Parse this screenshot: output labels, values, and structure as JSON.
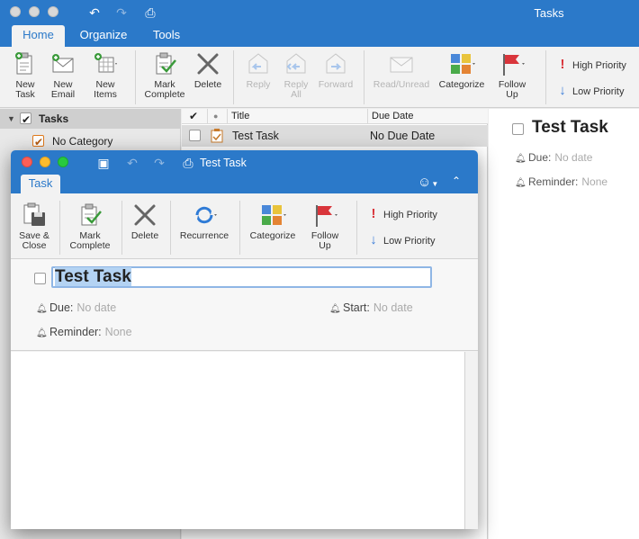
{
  "main": {
    "title": "Tasks",
    "tabs": [
      "Home",
      "Organize",
      "Tools"
    ],
    "ribbon": {
      "new_task": [
        "New",
        "Task"
      ],
      "new_email": [
        "New",
        "Email"
      ],
      "new_items": [
        "New",
        "Items"
      ],
      "mark_complete": [
        "Mark",
        "Complete"
      ],
      "delete": "Delete",
      "reply": "Reply",
      "reply_all": [
        "Reply",
        "All"
      ],
      "forward": "Forward",
      "read_unread": "Read/Unread",
      "categorize": "Categorize",
      "follow_up": [
        "Follow",
        "Up"
      ],
      "high_priority": "High Priority",
      "low_priority": "Low Priority"
    },
    "nav": {
      "tasks": "Tasks",
      "no_category": "No Category"
    },
    "list": {
      "col_title": "Title",
      "col_due": "Due Date",
      "row_title": "Test Task",
      "row_due": "No Due Date"
    },
    "reading": {
      "title": "Test Task",
      "due_label": "Due:",
      "due_value": "No date",
      "reminder_label": "Reminder:",
      "reminder_value": "None"
    }
  },
  "task_window": {
    "title": "Test Task",
    "tab": "Task",
    "ribbon": {
      "save_close": [
        "Save &",
        "Close"
      ],
      "mark_complete": [
        "Mark",
        "Complete"
      ],
      "delete": "Delete",
      "recurrence": "Recurrence",
      "categorize": "Categorize",
      "follow_up": [
        "Follow",
        "Up"
      ],
      "high_priority": "High Priority",
      "low_priority": "Low Priority"
    },
    "form": {
      "title_value": "Test Task",
      "due_label": "Due:",
      "due_value": "No date",
      "start_label": "Start:",
      "start_value": "No date",
      "reminder_label": "Reminder:",
      "reminder_value": "None"
    }
  },
  "colors": {
    "titlebar": "#2b79c9",
    "flag_red": "#d9353b",
    "priority_red": "#d9353b",
    "priority_blue": "#3b7dd8",
    "check_green": "#3a9a3a"
  }
}
